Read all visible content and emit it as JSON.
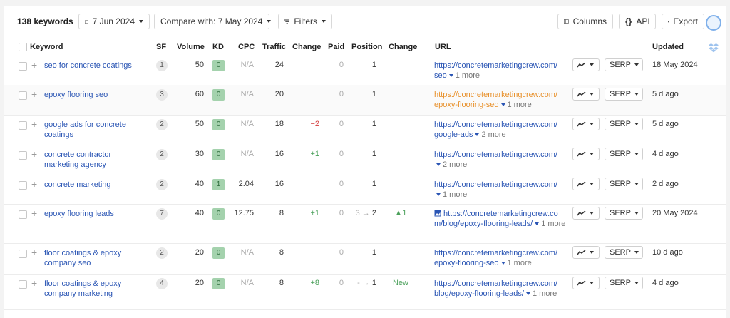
{
  "toolbar": {
    "keyword_count": "138 keywords",
    "date": "7 Jun 2024",
    "compare": "Compare with: 7 May 2024",
    "filters": "Filters",
    "columns": "Columns",
    "api": "API",
    "export": "Export"
  },
  "columns": {
    "keyword": "Keyword",
    "sf": "SF",
    "volume": "Volume",
    "kd": "KD",
    "cpc": "CPC",
    "traffic": "Traffic",
    "change": "Change",
    "paid": "Paid",
    "position": "Position",
    "pos_change": "Change",
    "url": "URL",
    "updated": "Updated"
  },
  "serp_label": "SERP",
  "rows": [
    {
      "keyword": "seo for concrete coatings",
      "sf": "1",
      "volume": "50",
      "kd": "0",
      "cpc": "N/A",
      "traffic": "24",
      "change": "",
      "paid": "0",
      "position": "1",
      "pos_change": "",
      "url1": "https://concretemarketingcrew.com/",
      "url2": "seo",
      "more": "1 more",
      "updated": "18 May 2024"
    },
    {
      "keyword": "epoxy flooring seo",
      "sf": "3",
      "volume": "60",
      "kd": "0",
      "cpc": "N/A",
      "traffic": "20",
      "change": "",
      "paid": "0",
      "position": "1",
      "pos_change": "",
      "url1": "https://concretemarketingcrew.com/",
      "url2": "epoxy-flooring-seo",
      "more": "1 more",
      "updated": "5 d ago"
    },
    {
      "keyword": "google ads for concrete coatings",
      "sf": "2",
      "volume": "50",
      "kd": "0",
      "cpc": "N/A",
      "traffic": "18",
      "change": "−2",
      "paid": "0",
      "position": "1",
      "pos_change": "",
      "url1": "https://concretemarketingcrew.com/",
      "url2": "google-ads",
      "more": "2 more",
      "updated": "5 d ago"
    },
    {
      "keyword": "concrete contractor marketing agency",
      "sf": "2",
      "volume": "30",
      "kd": "0",
      "cpc": "N/A",
      "traffic": "16",
      "change": "+1",
      "paid": "0",
      "position": "1",
      "pos_change": "",
      "url1": "https://concretemarketingcrew.com/",
      "url2": "",
      "more": "2 more",
      "updated": "4 d ago"
    },
    {
      "keyword": "concrete marketing",
      "sf": "2",
      "volume": "40",
      "kd": "1",
      "cpc": "2.04",
      "traffic": "16",
      "change": "",
      "paid": "0",
      "position": "1",
      "pos_change": "",
      "url1": "https://concretemarketingcrew.com/",
      "url2": "",
      "more": "1 more",
      "updated": "2 d ago"
    },
    {
      "keyword": "epoxy flooring leads",
      "sf": "7",
      "volume": "40",
      "kd": "0",
      "cpc": "12.75",
      "traffic": "8",
      "change": "+1",
      "paid": "0",
      "position_from": "3",
      "position": "2",
      "pos_change": "▲1",
      "url1": "https://concretemarketingcrew.co",
      "url2": "m/blog/epoxy-flooring-leads/",
      "more": "1 more",
      "updated": "20 May 2024"
    },
    {
      "keyword": "floor coatings & epoxy company seo",
      "sf": "2",
      "volume": "20",
      "kd": "0",
      "cpc": "N/A",
      "traffic": "8",
      "change": "",
      "paid": "0",
      "position": "1",
      "pos_change": "",
      "url1": "https://concretemarketingcrew.com/",
      "url2": "epoxy-flooring-seo",
      "more": "1 more",
      "updated": "10 d ago"
    },
    {
      "keyword": "floor coatings & epoxy company marketing",
      "sf": "4",
      "volume": "20",
      "kd": "0",
      "cpc": "N/A",
      "traffic": "8",
      "change": "+8",
      "paid": "0",
      "position_from": "-",
      "position": "1",
      "pos_change": "New",
      "url1": "https://concretemarketingcrew.com/",
      "url2": "blog/epoxy-flooring-leads/",
      "more": "1 more",
      "updated": "4 d ago"
    }
  ]
}
